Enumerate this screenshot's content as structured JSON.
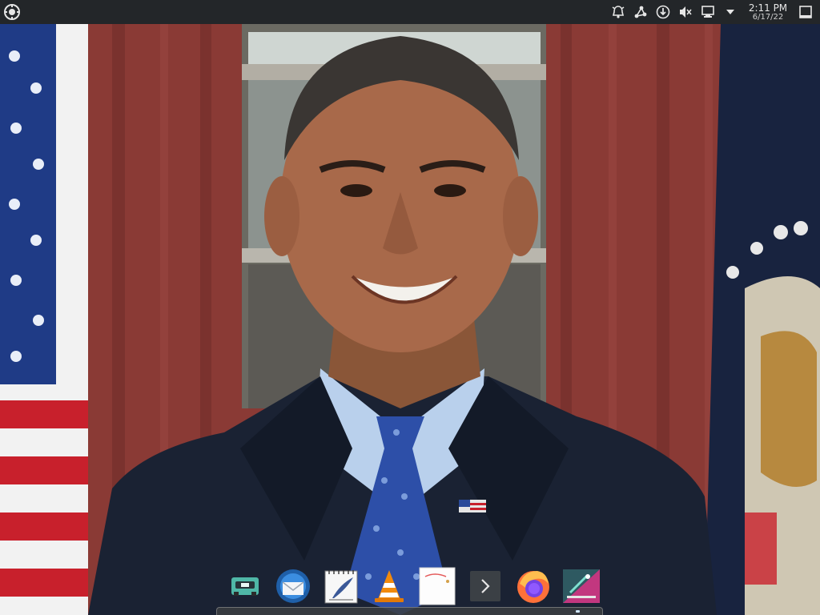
{
  "desktop": {
    "wallpaper": "portrait-photo-with-flags-and-curtains"
  },
  "top_panel": {
    "background": "#232629",
    "launcher_icon": "app-launcher-gear-icon",
    "tray": [
      {
        "name": "alarm-bell-icon"
      },
      {
        "name": "kde-connect-icon"
      },
      {
        "name": "updates-icon"
      },
      {
        "name": "volume-muted-icon"
      },
      {
        "name": "network-wired-icon"
      },
      {
        "name": "expand-tray-arrow-icon"
      }
    ],
    "clock": {
      "time": "2:11 PM",
      "date": "6/17/22"
    },
    "show_desktop_icon": "show-desktop-icon"
  },
  "dock": {
    "items": [
      {
        "name": "tape-recorder-app",
        "icon": "cassette-icon"
      },
      {
        "name": "mail-client",
        "icon": "envelope-globe-icon"
      },
      {
        "name": "text-editor",
        "icon": "notepad-feather-icon"
      },
      {
        "name": "vlc-player",
        "icon": "traffic-cone-icon"
      },
      {
        "name": "image-viewer",
        "icon": "paper-icon"
      },
      {
        "name": "terminal",
        "icon": "terminal-chevron-icon"
      },
      {
        "name": "firefox",
        "icon": "firefox-icon"
      },
      {
        "name": "software-center",
        "icon": "store-icon"
      }
    ],
    "accent": "#cfe7ff"
  }
}
